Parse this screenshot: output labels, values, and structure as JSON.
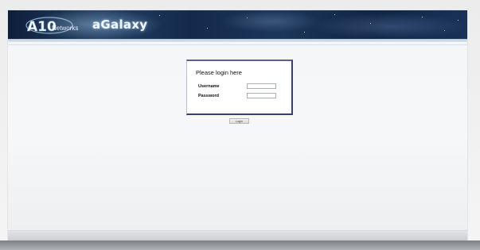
{
  "header": {
    "brand_left": "A10",
    "brand_sub": "Networks",
    "product_name": "aGalaxy"
  },
  "login": {
    "title": "Please login here",
    "username_label": "Username",
    "password_label": "Password",
    "username_value": "",
    "password_value": "",
    "submit_label": "Login"
  },
  "colors": {
    "banner_dark": "#0d1f3a",
    "login_border": "#3a3f72",
    "background": "#f4f6f8"
  }
}
